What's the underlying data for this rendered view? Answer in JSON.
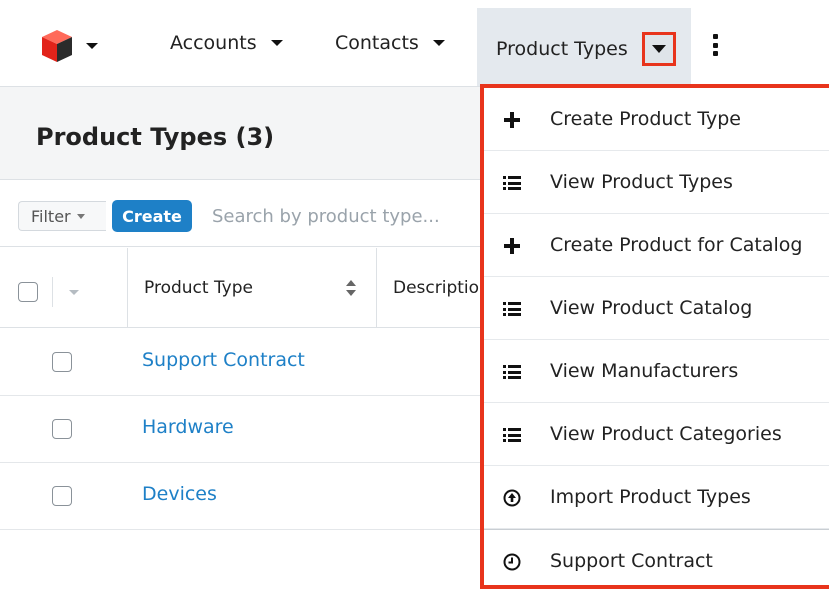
{
  "nav": {
    "items": [
      {
        "label": "Accounts"
      },
      {
        "label": "Contacts"
      },
      {
        "label": "Product Types"
      }
    ]
  },
  "list": {
    "title": "Product Types (3)",
    "filter_label": "Filter",
    "create_label": "Create",
    "search_placeholder": "Search by product type...",
    "columns": {
      "product_type": "Product Type",
      "description": "Description"
    },
    "rows": [
      {
        "name": "Support Contract"
      },
      {
        "name": "Hardware"
      },
      {
        "name": "Devices"
      }
    ]
  },
  "dropdown": {
    "items": [
      {
        "label": "Create Product Type",
        "icon": "plus-icon"
      },
      {
        "label": "View Product Types",
        "icon": "list-icon"
      },
      {
        "label": "Create Product for Catalog",
        "icon": "plus-icon"
      },
      {
        "label": "View Product Catalog",
        "icon": "list-icon"
      },
      {
        "label": "View Manufacturers",
        "icon": "list-icon"
      },
      {
        "label": "View Product Categories",
        "icon": "list-icon"
      },
      {
        "label": "Import Product Types",
        "icon": "upload-circle-icon"
      },
      {
        "label": "Support Contract",
        "icon": "clock-icon"
      }
    ]
  },
  "colors": {
    "accent_link": "#1e80c7",
    "highlight_border": "#e8341c",
    "nav_active_bg": "#e4e9ee"
  }
}
